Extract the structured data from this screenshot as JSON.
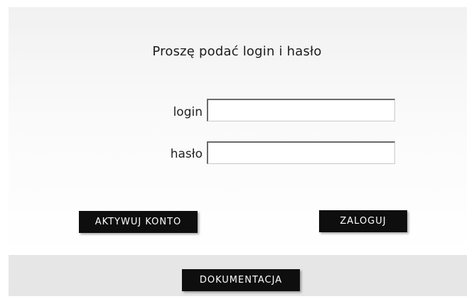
{
  "form": {
    "title": "Proszę podać login i hasło",
    "login_label": "login",
    "login_value": "",
    "password_label": "hasło",
    "password_value": ""
  },
  "buttons": {
    "activate_label": "AKTYWUJ KONTO",
    "login_label": "ZALOGUJ",
    "docs_label": "DOKUMENTACJA"
  },
  "colors": {
    "button_bg": "#0e0e0e",
    "button_text": "#ffffff",
    "footer_bg": "#e6e6e6"
  }
}
